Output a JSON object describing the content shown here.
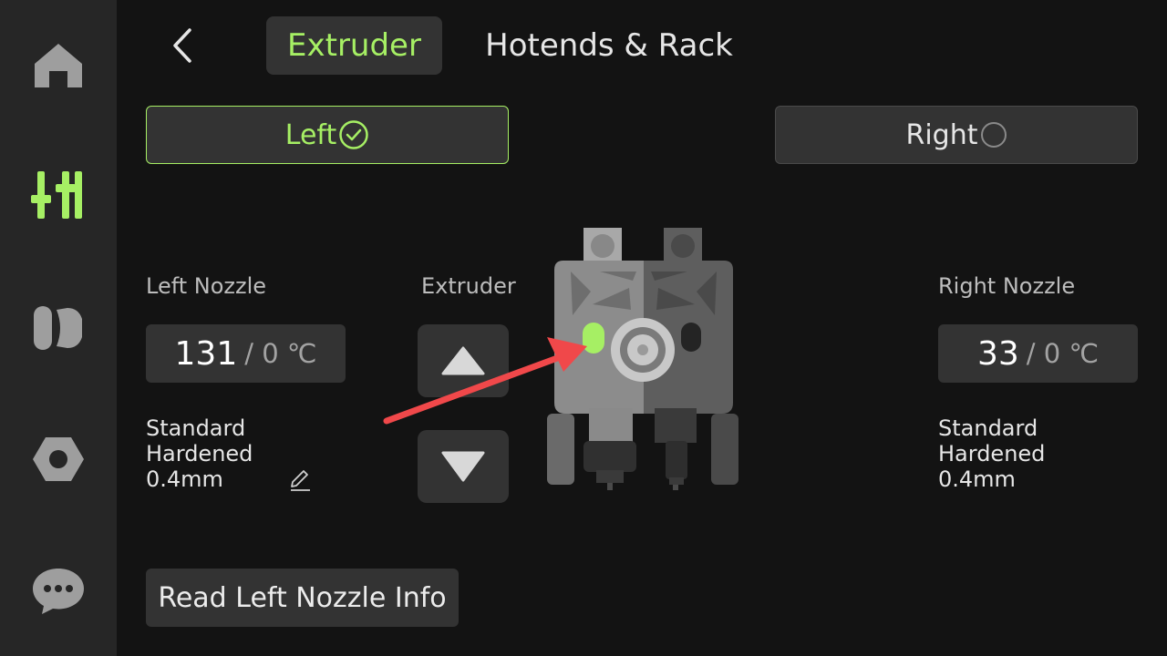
{
  "sidebar": {
    "items": [
      {
        "name": "home",
        "icon": "home-icon",
        "active": false
      },
      {
        "name": "controls",
        "icon": "sliders-icon",
        "active": true
      },
      {
        "name": "filament",
        "icon": "filament-spool-icon",
        "active": false
      },
      {
        "name": "settings",
        "icon": "hex-nut-icon",
        "active": false
      },
      {
        "name": "messages",
        "icon": "chat-bubble-icon",
        "active": false
      }
    ]
  },
  "header": {
    "tabs": [
      {
        "label": "Extruder",
        "active": true
      },
      {
        "label": "Hotends & Rack",
        "active": false
      }
    ]
  },
  "selector": {
    "left_label": "Left",
    "right_label": "Right",
    "selected": "Left"
  },
  "left_nozzle": {
    "title": "Left Nozzle",
    "current_temp": "131",
    "target_temp": "/ 0 ℃",
    "type_line1": "Standard",
    "type_line2": "Hardened",
    "diameter": "0.4mm"
  },
  "extruder": {
    "title": "Extruder"
  },
  "right_nozzle": {
    "title": "Right Nozzle",
    "current_temp": "33",
    "target_temp": "/ 0 ℃",
    "type_line1": "Standard",
    "type_line2": "Hardened",
    "diameter": "0.4mm"
  },
  "actions": {
    "read_info_label": "Read Left Nozzle Info"
  },
  "colors": {
    "accent": "#a6ef64",
    "background": "#131313",
    "sidebar": "#262626",
    "panel": "#333333",
    "arrow": "#f0484a"
  }
}
